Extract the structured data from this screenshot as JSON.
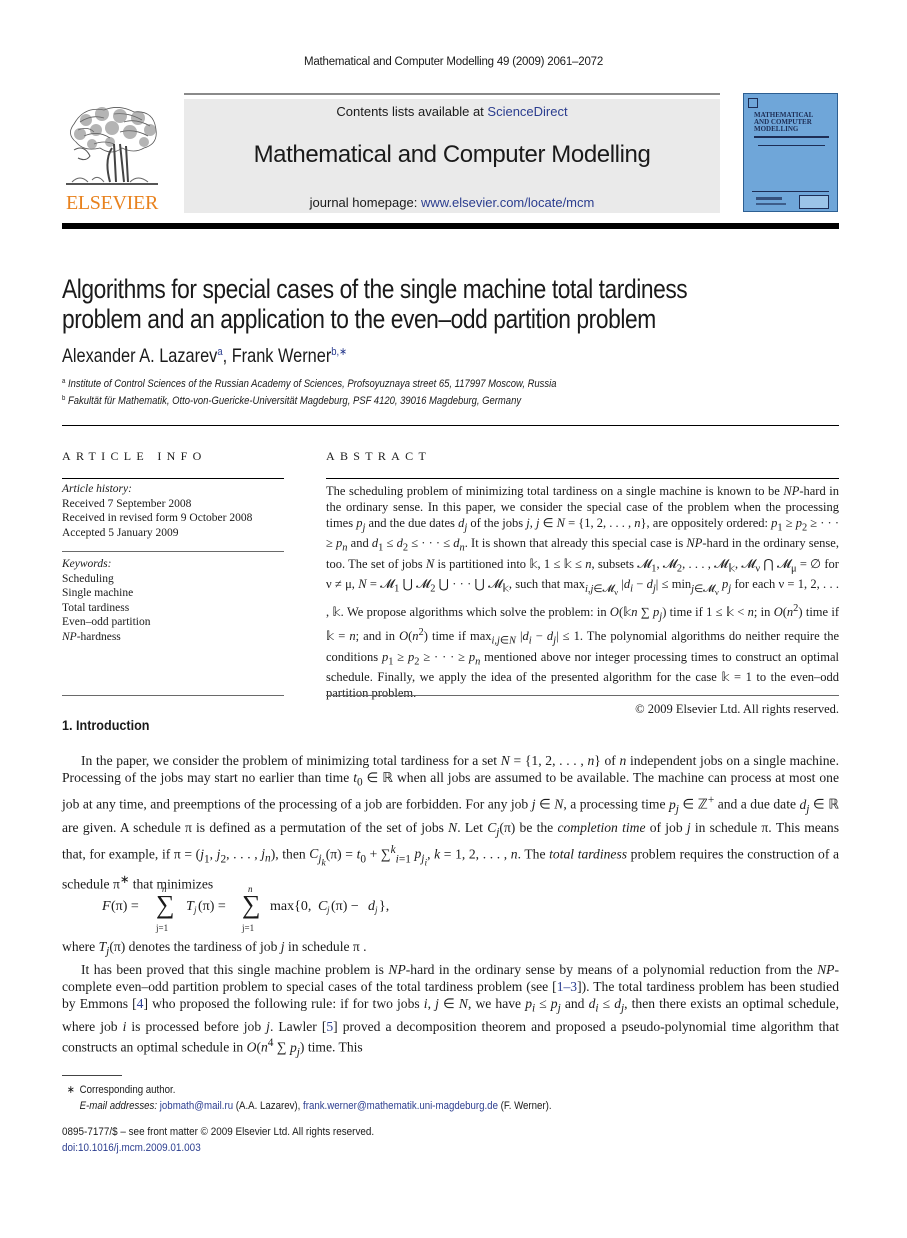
{
  "running_head": "Mathematical and Computer Modelling 49 (2009) 2061–2072",
  "banner": {
    "contents_prefix": "Contents lists available at ",
    "contents_link": "ScienceDirect",
    "journal_title": "Mathematical and Computer Modelling",
    "homepage_prefix": "journal homepage: ",
    "homepage_link": "www.elsevier.com/locate/mcm"
  },
  "publisher_logo": {
    "wordmark": "ELSEVIER",
    "color": "#e8821e"
  },
  "cover": {
    "title": "MATHEMATICAL\nAND COMPUTER\nMODELLING",
    "color": "#6fa6d9"
  },
  "article": {
    "title_line1": "Algorithms for special cases of the single machine total tardiness",
    "title_line2": "problem and an application to the even–odd partition problem",
    "authors": [
      {
        "name": "Alexander A. Lazarev",
        "marks": "a"
      },
      {
        "name": "Frank Werner",
        "marks": "b,∗"
      }
    ],
    "author_separator": ", ",
    "affiliations": [
      {
        "mark": "a",
        "text": "Institute of Control Sciences of the Russian Academy of Sciences, Profsoyuznaya street 65, 117997 Moscow, Russia"
      },
      {
        "mark": "b",
        "text": "Fakultät für Mathematik, Otto-von-Guericke-Universität Magdeburg, PSF 4120, 39016 Magdeburg, Germany"
      }
    ]
  },
  "article_info": {
    "heading": "ARTICLE INFO",
    "history_label": "Article history:",
    "history": [
      "Received 7 September 2008",
      "Received in revised form 9 October 2008",
      "Accepted 5 January 2009"
    ],
    "keywords_label": "Keywords:",
    "keywords": [
      "Scheduling",
      "Single machine",
      "Total tardiness",
      "Even–odd partition"
    ],
    "keyword_np_italic": "NP",
    "keyword_np_rest": "-hardness"
  },
  "abstract": {
    "heading": "ABSTRACT",
    "copyright": "© 2009 Elsevier Ltd. All rights reserved."
  },
  "intro": {
    "heading": "1. Introduction"
  },
  "references": {
    "r1_3": "1–3",
    "r4": "4",
    "r5": "5"
  },
  "footnotes": {
    "star": "∗",
    "corresponding": "Corresponding author.",
    "email_label": "E-mail addresses:",
    "email1": "jobmath@mail.ru",
    "email1_owner": " (A.A. Lazarev), ",
    "email2": "frank.werner@mathematik.uni-magdeburg.de",
    "email2_owner": " (F. Werner).",
    "front_matter": "0895-7177/$ – see front matter © 2009 Elsevier Ltd. All rights reserved.",
    "doi": "doi:10.1016/j.mcm.2009.01.003"
  }
}
